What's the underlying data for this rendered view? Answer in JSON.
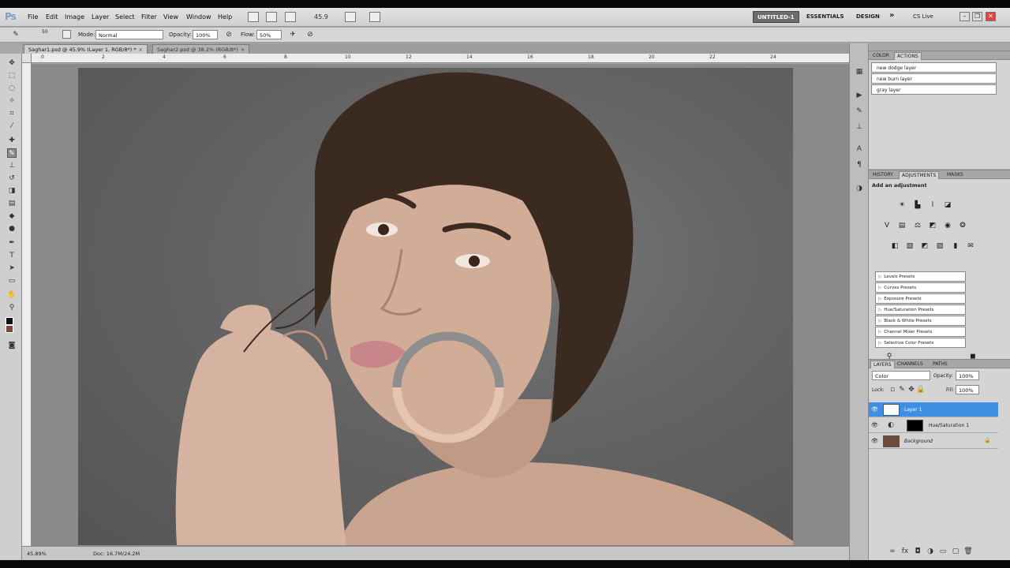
{
  "app": {
    "logo": "Ps",
    "menu": [
      "File",
      "Edit",
      "Image",
      "Layer",
      "Select",
      "Filter",
      "View",
      "Window",
      "Help"
    ],
    "zoom_display": "45.9",
    "workspaces": [
      "UNTITLED-1",
      "ESSENTIALS",
      "DESIGN"
    ],
    "workspace_overflow": "»",
    "cs_live": "CS Live"
  },
  "options": {
    "mode_label": "Mode:",
    "mode_value": "Normal",
    "opacity_label": "Opacity:",
    "opacity_value": "100%",
    "flow_label": "Flow:",
    "flow_value": "50%",
    "brush_size": "50"
  },
  "documents": [
    {
      "title": "Saghar1.psd @ 45.9% (Layer 1, RGB/8*) *",
      "active": true
    },
    {
      "title": "Saghar2.psd @ 38.2% (RGB/8*)",
      "active": false
    }
  ],
  "ruler_numbers": [
    "0",
    "2",
    "4",
    "6",
    "8",
    "10",
    "12",
    "14",
    "16",
    "18",
    "20",
    "22",
    "24"
  ],
  "status": {
    "zoom": "45.89%",
    "doc": "Doc: 16.7M/24.2M"
  },
  "panels": {
    "color_tabs": [
      "COLOR",
      "ACTIONS"
    ],
    "actions": [
      "new dodge layer",
      "new burn layer",
      "gray layer"
    ],
    "adj_tabs": [
      "HISTORY",
      "ADJUSTMENTS",
      "MASKS"
    ],
    "adj_title": "Add an adjustment",
    "presets": [
      "Levels Presets",
      "Curves Presets",
      "Exposure Presets",
      "Hue/Saturation Presets",
      "Black & White Presets",
      "Channel Mixer Presets",
      "Selective Color Presets"
    ],
    "layer_tabs": [
      "LAYERS",
      "CHANNELS",
      "PATHS"
    ],
    "blend_mode": "Color",
    "opacity_label": "Opacity:",
    "opacity_value": "100%",
    "lock_label": "Lock:",
    "fill_label": "Fill:",
    "fill_value": "100%",
    "layers": [
      {
        "name": "Layer 1",
        "selected": true
      },
      {
        "name": "Hue/Saturation 1",
        "selected": false
      },
      {
        "name": "Background",
        "selected": false
      }
    ]
  },
  "colors": {
    "foreground": "#111111",
    "background": "#7a4a3a",
    "selection": "#3c8fe3",
    "ring_gray": "#8e8e8e",
    "ring_skin": "#e7c4b0"
  }
}
